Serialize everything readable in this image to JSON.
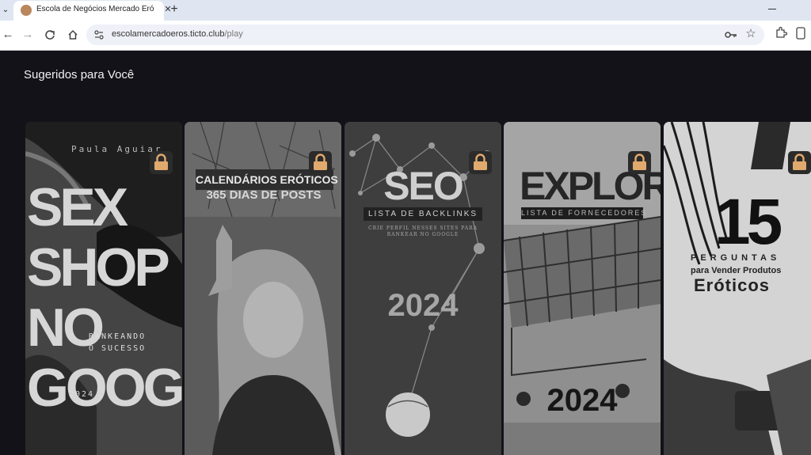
{
  "browser": {
    "tab_title": "Escola de Negócios Mercado Eró",
    "url_host": "escolamercadoeros.ticto.club",
    "url_path": "/play",
    "icons": [
      "tab-menu-icon",
      "favicon-icon",
      "close-icon",
      "plus-icon",
      "back-icon",
      "forward-icon",
      "reload-icon",
      "home-icon",
      "site-info-icon",
      "key-icon",
      "star-icon",
      "extensions-icon"
    ]
  },
  "page": {
    "section_title": "Sugeridos para Você"
  },
  "cards": [
    {
      "author": "Paula Aguiar",
      "lines": [
        "SEX",
        "SHOP",
        "NO",
        "GOOGLE"
      ],
      "sub1": "RANKEANDO",
      "sub2": "O SUCESSO",
      "year": "2024"
    },
    {
      "title1": "CALENDÁRIOS ERÓTICOS",
      "title2": "365 DIAS DE POSTS"
    },
    {
      "title": "SEO",
      "subtitle": "LISTA DE BACKLINKS",
      "small1": "CRIE PERFIL NESSES SITES PARA",
      "small2": "RANKEAR NO GOOGLE",
      "year": "2024"
    },
    {
      "title": "EXPLORE",
      "subtitle": "LISTA DE FORNECEDORES",
      "year": "2024"
    },
    {
      "number": "15",
      "line1": "PERGUNTAS",
      "line2": "para Vender Produtos",
      "line3": "Eróticos"
    }
  ]
}
